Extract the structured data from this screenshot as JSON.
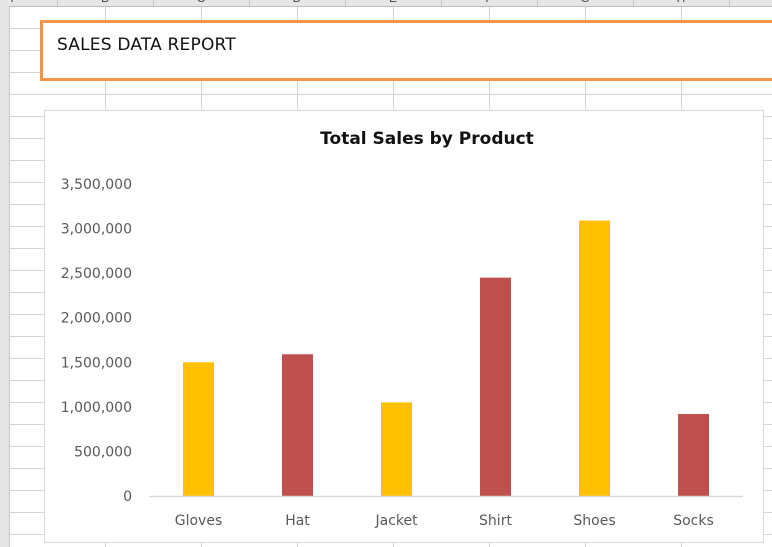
{
  "sheet": {
    "column_letters": [
      "A",
      "B",
      "C",
      "D",
      "E",
      "F",
      "G",
      "H"
    ]
  },
  "report": {
    "title": "SALES DATA REPORT"
  },
  "colors": {
    "title_border": "#f0954a",
    "bar_yellow": "#ffc000",
    "bar_red": "#c0504d",
    "axis_line": "#d9d9d9"
  },
  "chart_data": {
    "type": "bar",
    "title": "Total Sales by Product",
    "xlabel": "",
    "ylabel": "",
    "categories": [
      "Gloves",
      "Hat",
      "Jacket",
      "Shirt",
      "Shoes",
      "Socks"
    ],
    "values": [
      1500000,
      1590000,
      1050000,
      2450000,
      3090000,
      920000
    ],
    "bar_colors": [
      "#ffc000",
      "#c0504d",
      "#ffc000",
      "#c0504d",
      "#ffc000",
      "#c0504d"
    ],
    "ylim": [
      0,
      3500000
    ],
    "yticks": [
      0,
      500000,
      1000000,
      1500000,
      2000000,
      2500000,
      3000000,
      3500000
    ],
    "ytick_labels": [
      "0",
      "500,000",
      "1,000,000",
      "1,500,000",
      "2,000,000",
      "2,500,000",
      "3,000,000",
      "3,500,000"
    ],
    "grid": false,
    "legend": "none"
  }
}
